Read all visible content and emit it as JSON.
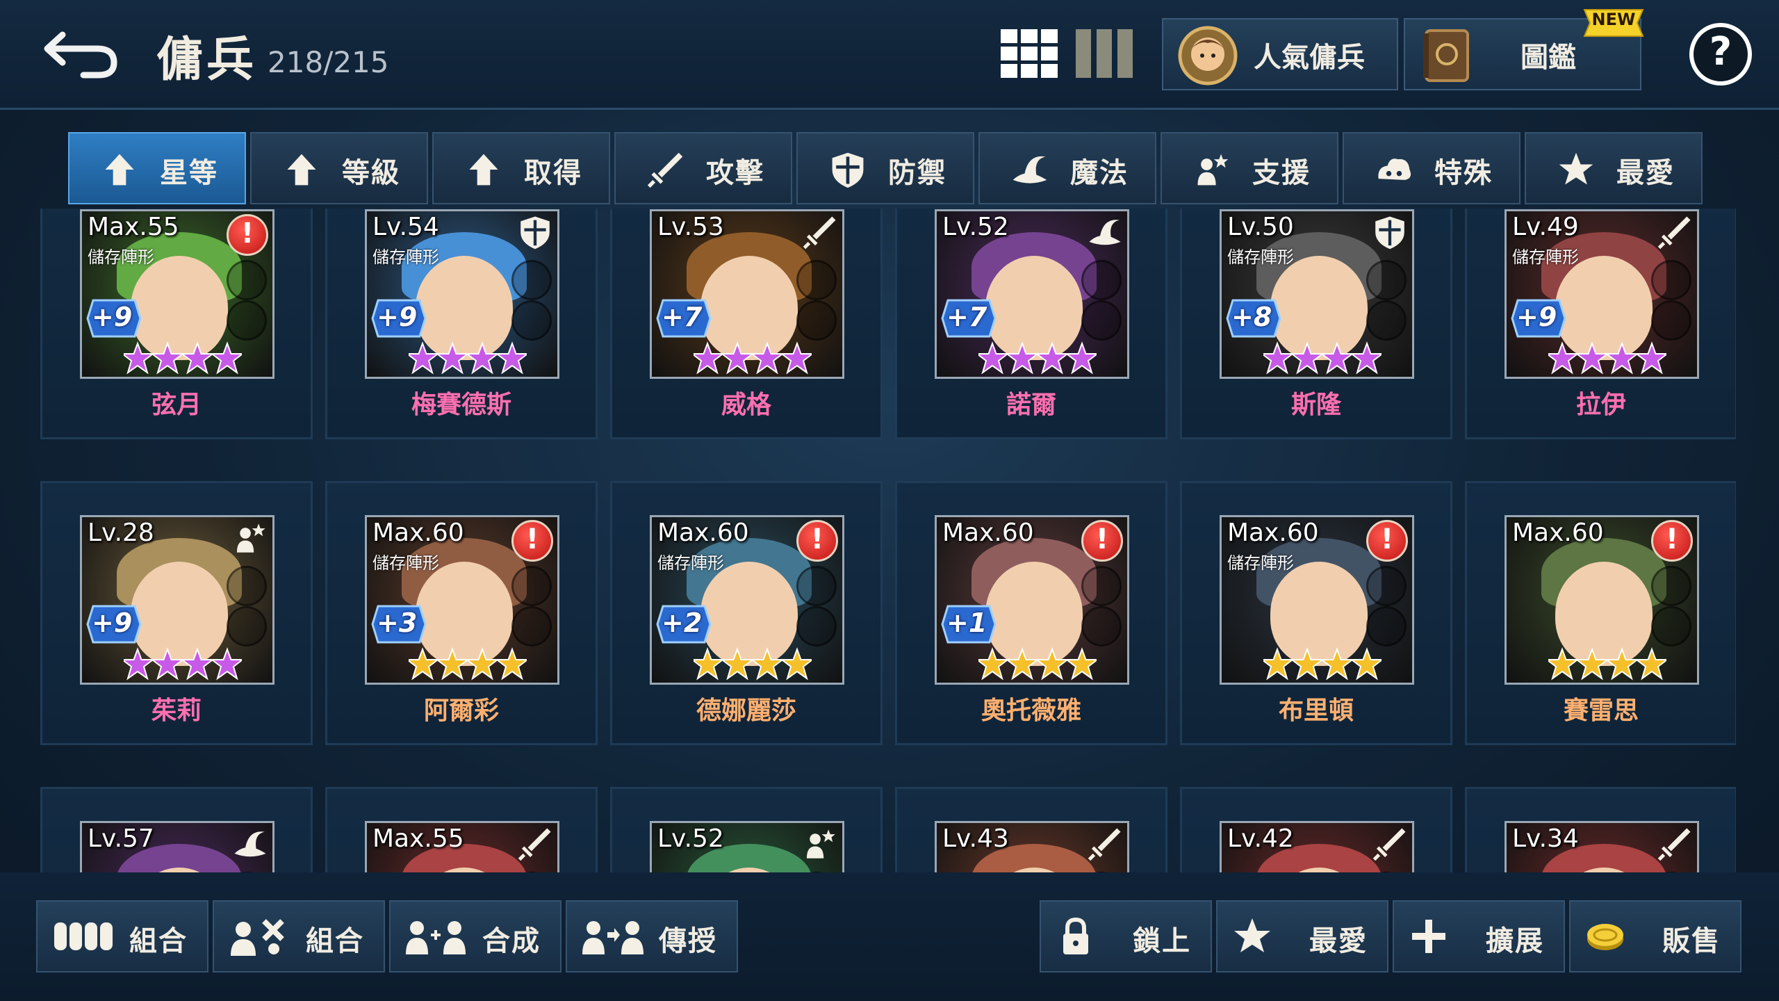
{
  "header": {
    "title": "傭兵",
    "count": "218/215",
    "popular_label": "人氣傭兵",
    "book_label": "圖鑑",
    "new_badge": "NEW",
    "help_label": "?"
  },
  "tabs": [
    {
      "label": "星等",
      "icon": "up-arrow-icon",
      "active": true
    },
    {
      "label": "等級",
      "icon": "up-arrow-icon",
      "active": false
    },
    {
      "label": "取得",
      "icon": "up-arrow-icon",
      "active": false
    },
    {
      "label": "攻擊",
      "icon": "sword-icon",
      "active": false
    },
    {
      "label": "防禦",
      "icon": "shield-icon",
      "active": false
    },
    {
      "label": "魔法",
      "icon": "wizard-hat-icon",
      "active": false
    },
    {
      "label": "支援",
      "icon": "support-icon",
      "active": false
    },
    {
      "label": "特殊",
      "icon": "special-icon",
      "active": false
    },
    {
      "label": "最愛",
      "icon": "star-icon",
      "active": false
    }
  ],
  "heroes": [
    {
      "name": "弦月",
      "level": "Max.55",
      "formation": "儲存陣形",
      "plus": "+9",
      "stars": 4,
      "star_color": "purple",
      "class": "alert",
      "name_color": "#ff6fb0",
      "bg": "#3d6a2a"
    },
    {
      "name": "梅賽德斯",
      "level": "Lv.54",
      "formation": "儲存陣形",
      "plus": "+9",
      "stars": 4,
      "star_color": "purple",
      "class": "shield-icon",
      "name_color": "#ff6fb0",
      "bg": "#2d5a86"
    },
    {
      "name": "威格",
      "level": "Lv.53",
      "formation": "",
      "plus": "+7",
      "stars": 4,
      "star_color": "purple",
      "class": "sword-icon",
      "name_color": "#ff6fb0",
      "bg": "#5a3a1a"
    },
    {
      "name": "諾爾",
      "level": "Lv.52",
      "formation": "",
      "plus": "+7",
      "stars": 4,
      "star_color": "purple",
      "class": "wizard-hat-icon",
      "name_color": "#ff6fb0",
      "bg": "#4a2a5a"
    },
    {
      "name": "斯隆",
      "level": "Lv.50",
      "formation": "儲存陣形",
      "plus": "+8",
      "stars": 4,
      "star_color": "purple",
      "class": "shield-icon",
      "name_color": "#ff6fb0",
      "bg": "#3a3a3a"
    },
    {
      "name": "拉伊",
      "level": "Lv.49",
      "formation": "儲存陣形",
      "plus": "+9",
      "stars": 4,
      "star_color": "purple",
      "class": "sword-icon",
      "name_color": "#ff6fb0",
      "bg": "#5a2a2a"
    },
    {
      "name": "茱莉",
      "level": "Lv.28",
      "formation": "",
      "plus": "+9",
      "stars": 4,
      "star_color": "purple",
      "class": "support-icon",
      "name_color": "#ff6fb0",
      "bg": "#6a5a3a"
    },
    {
      "name": "阿爾彩",
      "level": "Max.60",
      "formation": "儲存陣形",
      "plus": "+3",
      "stars": 4,
      "star_color": "gold",
      "class": "alert",
      "name_color": "#ffb070",
      "bg": "#5a3a2a"
    },
    {
      "name": "德娜麗莎",
      "level": "Max.60",
      "formation": "儲存陣形",
      "plus": "+2",
      "stars": 4,
      "star_color": "gold",
      "class": "alert",
      "name_color": "#ffb070",
      "bg": "#2a4a5a"
    },
    {
      "name": "奧托薇雅",
      "level": "Max.60",
      "formation": "",
      "plus": "+1",
      "stars": 4,
      "star_color": "gold",
      "class": "alert",
      "name_color": "#ffb070",
      "bg": "#5a3a3a"
    },
    {
      "name": "布里頓",
      "level": "Max.60",
      "formation": "儲存陣形",
      "plus": "",
      "stars": 4,
      "star_color": "gold",
      "class": "alert",
      "name_color": "#ffb070",
      "bg": "#2a3440"
    },
    {
      "name": "賽雷思",
      "level": "Max.60",
      "formation": "",
      "plus": "",
      "stars": 4,
      "star_color": "gold",
      "class": "alert",
      "name_color": "#ffb070",
      "bg": "#3a4a2a"
    },
    {
      "name": "",
      "level": "Lv.57",
      "formation": "",
      "plus": "",
      "stars": 0,
      "star_color": "purple",
      "class": "wizard-hat-icon",
      "name_color": "#ff6fb0",
      "bg": "#4a2a5a"
    },
    {
      "name": "",
      "level": "Max.55",
      "formation": "",
      "plus": "",
      "stars": 0,
      "star_color": "gold",
      "class": "sword-icon",
      "name_color": "#ffb070",
      "bg": "#6a2a2a"
    },
    {
      "name": "",
      "level": "Lv.52",
      "formation": "",
      "plus": "",
      "stars": 0,
      "star_color": "gold",
      "class": "support-icon",
      "name_color": "#ffb070",
      "bg": "#2a5a3a"
    },
    {
      "name": "",
      "level": "Lv.43",
      "formation": "",
      "plus": "",
      "stars": 0,
      "star_color": "gold",
      "class": "sword-icon",
      "name_color": "#ffb070",
      "bg": "#6a3a2a"
    },
    {
      "name": "",
      "level": "Lv.42",
      "formation": "",
      "plus": "",
      "stars": 0,
      "star_color": "gold",
      "class": "sword-icon",
      "name_color": "#ffb070",
      "bg": "#6a2a2a"
    },
    {
      "name": "",
      "level": "Lv.34",
      "formation": "",
      "plus": "",
      "stars": 0,
      "star_color": "gold",
      "class": "sword-icon",
      "name_color": "#ffb070",
      "bg": "#6a2a2a"
    }
  ],
  "bottom": [
    {
      "label": "組合",
      "icon": "group-icon"
    },
    {
      "label": "組合",
      "icon": "combine-icon"
    },
    {
      "label": "合成",
      "icon": "synthesize-icon"
    },
    {
      "label": "傳授",
      "icon": "transfer-icon"
    },
    {
      "label": "鎖上",
      "icon": "lock-icon"
    },
    {
      "label": "最愛",
      "icon": "star-icon"
    },
    {
      "label": "擴展",
      "icon": "plus-icon"
    },
    {
      "label": "販售",
      "icon": "coin-icon"
    }
  ],
  "colors": {
    "accent_tab": "#2f7ec4",
    "purple_star": "#c85ae8",
    "gold_star": "#f5c02a",
    "alert_red": "#d01818"
  }
}
